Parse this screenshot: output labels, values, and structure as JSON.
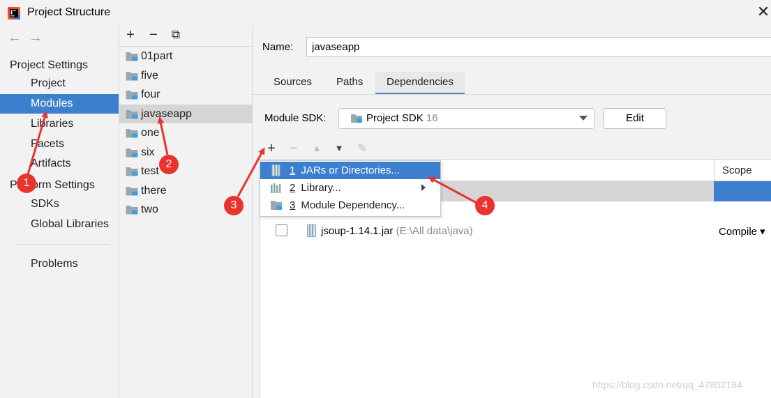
{
  "window": {
    "title": "Project Structure",
    "close_glyph": "✕"
  },
  "nav": {
    "back_icon": "←",
    "forward_icon": "→",
    "project_settings_header": "Project Settings",
    "project_settings_items": [
      "Project",
      "Modules",
      "Libraries",
      "Facets",
      "Artifacts"
    ],
    "platform_settings_header": "Platform Settings",
    "platform_settings_items": [
      "SDKs",
      "Global Libraries"
    ],
    "problems": "Problems",
    "selected": "Modules"
  },
  "modules": {
    "toolbar": {
      "add": "+",
      "remove": "−",
      "copy": "⧉"
    },
    "items": [
      "01part",
      "five",
      "four",
      "javaseapp",
      "one",
      "six",
      "test",
      "there",
      "two"
    ],
    "selected": "javaseapp"
  },
  "module_settings": {
    "name_label": "Name:",
    "name_value": "javaseapp",
    "tabs": [
      "Sources",
      "Paths",
      "Dependencies"
    ],
    "active_tab": "Dependencies",
    "sdk_label": "Module SDK:",
    "sdk_value": "Project SDK",
    "sdk_version": "16",
    "edit_button": "Edit"
  },
  "dependencies": {
    "toolbar": {
      "add": "+",
      "remove": "−",
      "up": "▲",
      "down": "▼",
      "edit": "✎"
    },
    "scope_header": "Scope",
    "rows": [
      {
        "name": "jsoup-1.14.1.jar",
        "path": "(E:\\All data\\java)",
        "scope": "Compile ▾",
        "checked": false
      }
    ]
  },
  "add_popup": {
    "items": [
      {
        "num": "1",
        "label": "JARs or Directories...",
        "icon": "jar-dir-icon",
        "highlighted": true
      },
      {
        "num": "2",
        "label": "Library...",
        "icon": "library-icon",
        "submenu": true
      },
      {
        "num": "3",
        "label": "Module Dependency...",
        "icon": "module-icon"
      }
    ]
  },
  "annotations": {
    "badges": [
      "1",
      "2",
      "3",
      "4"
    ],
    "color": "#e8332f"
  },
  "colors": {
    "selection_blue": "#3d7fcf",
    "row_grey": "#d5d5d5",
    "tab_underline": "#4a88c7"
  },
  "watermark": "https://blog.csdn.net/qq_47802184"
}
